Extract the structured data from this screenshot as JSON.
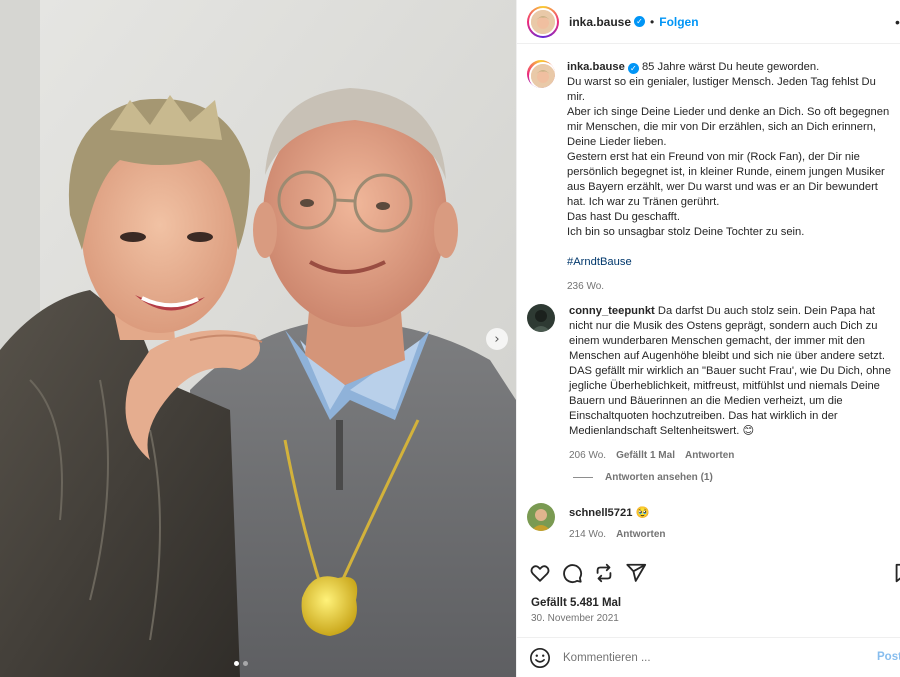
{
  "post": {
    "username": "inka.bause",
    "follow_label": "Folgen",
    "separator": "•",
    "more_label": "•",
    "caption_lines": [
      "85 Jahre wärst Du heute geworden.",
      "Du warst so ein genialer, lustiger Mensch. Jeden Tag fehlst Du",
      "mir.",
      "Aber ich singe Deine Lieder und denke an Dich. So oft begegnen",
      "mir Menschen, die mir von Dir erzählen, sich an Dich erinnern,",
      "Deine Lieder lieben.",
      "Gestern erst hat ein Freund von mir (Rock Fan), der Dir nie",
      "persönlich begegnet ist, in kleiner Runde, einem jungen Musiker",
      "aus Bayern erzählt, wer Du warst und was er an Dir bewundert",
      "hat. Ich war zu Tränen gerührt.",
      "Das hast Du geschafft.",
      "Ich bin so unsagbar stolz Deine Tochter zu sein."
    ],
    "hashtag": "#ArndtBause",
    "caption_age": "236 Wo.",
    "likes": "Gefällt 5.481 Mal",
    "date": "30. November 2021",
    "image_count": 2,
    "active_image": 1
  },
  "comments": [
    {
      "username": "conny_teepunkt",
      "text": "Da darfst Du auch stolz sein. Dein Papa hat nicht nur die Musik des Ostens geprägt, sondern auch Dich zu einem wunderbaren Menschen gemacht, der immer mit den Menschen auf Augenhöhe bleibt und sich nie über andere setzt. DAS gefällt mir wirklich an \"Bauer sucht Frau', wie Du Dich, ohne jegliche Überheblichkeit, mitfreust, mitfühlst und niemals Deine Bauern und Bäuerinnen an die Medien verheizt, um die Einschaltquoten hochzutreiben. Das hat wirklich in der Medienlandschaft Seltenheitswert. 😊",
      "age": "206 Wo.",
      "likes": "Gefällt 1 Mal",
      "reply_label": "Antworten",
      "view_replies": "Antworten ansehen (1)"
    },
    {
      "username": "schnell5721",
      "text": "🥹",
      "age": "214 Wo.",
      "reply_label": "Antworten"
    }
  ],
  "comment_bar": {
    "placeholder": "Kommentieren ...",
    "post_label": "Post"
  },
  "colors": {
    "accent": "#0095f6",
    "hashtag": "#00376b",
    "muted": "#737373",
    "post_disabled": "#87bdee"
  },
  "icons": [
    "heart-icon",
    "comment-icon",
    "share-icon",
    "send-icon",
    "bookmark-icon",
    "emoji-icon",
    "verified-icon",
    "chevron-right-icon"
  ]
}
